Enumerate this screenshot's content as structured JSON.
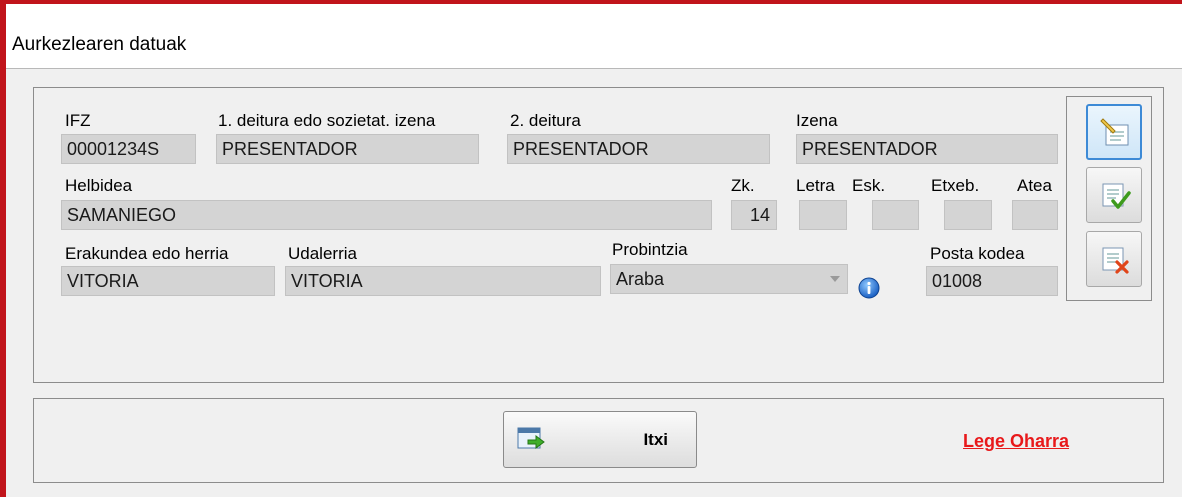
{
  "window": {
    "title": "Aurkezlearen datuak"
  },
  "fields": {
    "ifz": {
      "label": "IFZ",
      "value": "00001234S"
    },
    "surname1": {
      "label": "1. deitura edo sozietat. izena",
      "value": "PRESENTADOR"
    },
    "surname2": {
      "label": "2. deitura",
      "value": "PRESENTADOR"
    },
    "name": {
      "label": "Izena",
      "value": "PRESENTADOR"
    },
    "address": {
      "label": "Helbidea",
      "value": "SAMANIEGO"
    },
    "number": {
      "label": "Zk.",
      "value": "14"
    },
    "letter": {
      "label": "Letra",
      "value": ""
    },
    "stair": {
      "label": "Esk.",
      "value": ""
    },
    "floor": {
      "label": "Etxeb.",
      "value": ""
    },
    "door": {
      "label": "Atea",
      "value": ""
    },
    "entity": {
      "label": "Erakundea edo herria",
      "value": "VITORIA"
    },
    "municipality": {
      "label": "Udalerria",
      "value": "VITORIA"
    },
    "province": {
      "label": "Probintzia",
      "value": "Araba"
    },
    "postal_code": {
      "label": "Posta kodea",
      "value": "01008"
    }
  },
  "side_buttons": [
    {
      "icon": "edit-icon",
      "state": "active"
    },
    {
      "icon": "accept-icon",
      "state": "normal"
    },
    {
      "icon": "cancel-icon",
      "state": "normal"
    }
  ],
  "footer": {
    "close_label": "Itxi",
    "close_icon": "exit-icon",
    "legal_link": "Lege Oharra"
  },
  "colors": {
    "frame": "#c1141b",
    "field_bg": "#d4d4d4",
    "link": "#e8191b",
    "active_border": "#3d8ad6"
  }
}
